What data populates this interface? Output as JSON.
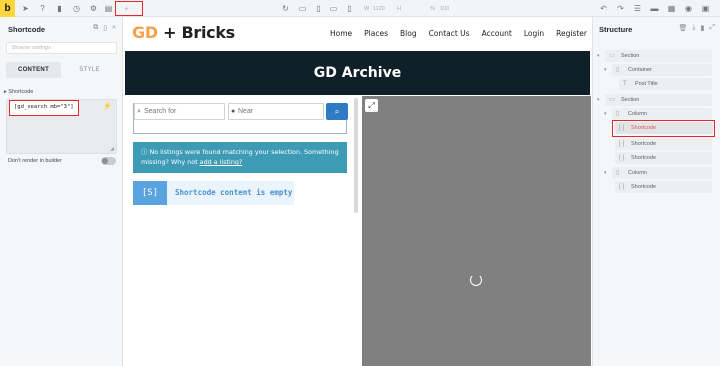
{
  "toolbar": {
    "brand": "b",
    "icons": [
      "cursor-icon",
      "help-icon",
      "page-icon",
      "history-icon",
      "settings-icon",
      "template-icon"
    ],
    "add_label": "+",
    "width_value": "1120",
    "height_value": "",
    "scale_value": "100"
  },
  "left_panel": {
    "title": "Shortcode",
    "search_placeholder": "Browse settings",
    "tabs": [
      {
        "label": "CONTENT",
        "active": true
      },
      {
        "label": "STYLE",
        "active": false
      }
    ],
    "field_label": "Shortcode",
    "shortcode_value": "[gd_search mb=\"3\"]",
    "toggle_label": "Don't render in builder",
    "toggle_on": false
  },
  "canvas": {
    "logo_part1": "GD",
    "logo_part2": " + Bricks",
    "nav": [
      "Home",
      "Places",
      "Blog",
      "Contact Us",
      "Account",
      "Login",
      "Register"
    ],
    "hero_title": "GD Archive",
    "search_for_placeholder": "Search for",
    "near_placeholder": "Near",
    "notice_text": "No listings were found matching your selection. Something missing? Why not ",
    "notice_link": "add a listing?",
    "shortcode_tag": "[S]",
    "shortcode_empty_text": "Shortcode content is empty"
  },
  "structure": {
    "title": "Structure",
    "items": [
      {
        "label": "Section",
        "icon": "section-icon"
      },
      {
        "label": "Container",
        "icon": "container-icon"
      },
      {
        "label": "Post Title",
        "icon": "heading-icon"
      },
      {
        "label": "Section",
        "icon": "section-icon"
      },
      {
        "label": "Column",
        "icon": "column-icon"
      },
      {
        "label": "Shortcode",
        "icon": "shortcode-icon",
        "selected": true
      },
      {
        "label": "Shortcode",
        "icon": "shortcode-icon"
      },
      {
        "label": "Shortcode",
        "icon": "shortcode-icon"
      },
      {
        "label": "Column",
        "icon": "column-icon"
      },
      {
        "label": "Shortcode",
        "icon": "shortcode-icon"
      }
    ]
  },
  "colors": {
    "brand": "#ffd53e",
    "highlight": "#e0282d",
    "hero_bg": "#102028",
    "notice_bg": "#3d9bb5",
    "search_button": "#2e7bc4"
  }
}
